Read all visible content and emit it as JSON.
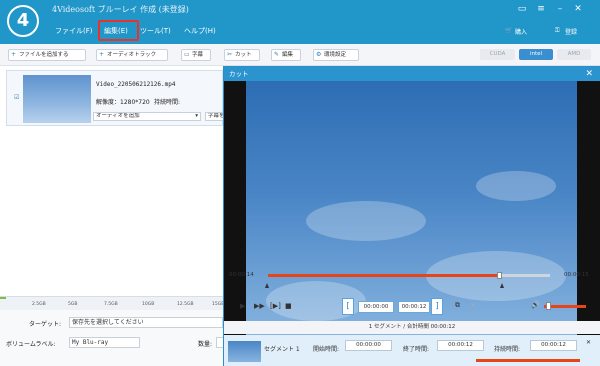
{
  "app": {
    "logo": "4",
    "title": "4Videosoft ブルーレイ 作成 (未登録)"
  },
  "menu": {
    "file": "ファイル(F)",
    "edit": "編集(E)",
    "tools": "ツール(T)",
    "help": "ヘルプ(H)"
  },
  "titlebar_right": {
    "purchase": "購入",
    "register": "登録"
  },
  "toolbar": {
    "add_file": "ファイルを追加する",
    "audio_track": "オーディオトラック",
    "subtitle": "字幕",
    "cut": "カット",
    "edit": "編集",
    "settings": "環境設定"
  },
  "hw": {
    "cuda": "CUDA",
    "intel": "intel",
    "amd": "AMD"
  },
  "file": {
    "name": "Video_220506212126.mp4",
    "resolution": "解像度：1280*720",
    "duration": "持続時間:",
    "audio_select": "オーディオを追加",
    "subtitle_select": "字幕を"
  },
  "capacity": {
    "ticks": [
      "2.5GB",
      "5GB",
      "7.5GB",
      "10GB",
      "12.5GB",
      "15GB"
    ]
  },
  "output": {
    "target_label": "ターゲット:",
    "target_value": "保存先を選択してください",
    "volume_label": "ボリュームラベル:",
    "volume_value": "My Blu-ray",
    "count_label": "数量:"
  },
  "cut_dialog": {
    "title": "カット",
    "time_start": "00:00:14",
    "time_end": "00:00:15",
    "progress": 0.82,
    "start_box": "00:00:00",
    "end_box": "00:00:12",
    "segment_info": "1 セグメント / 合計時間 00:00:12",
    "segment": {
      "name": "セグメント 1",
      "start_label": "開始時間:",
      "start": "00:00:00",
      "end_label": "終了時間:",
      "end": "00:00:12",
      "dur_label": "持続時間:",
      "dur": "00:00:12"
    }
  },
  "colors": {
    "titlebar": "#2196c9",
    "accent": "#e8441a",
    "highlight": "#e8322c"
  }
}
